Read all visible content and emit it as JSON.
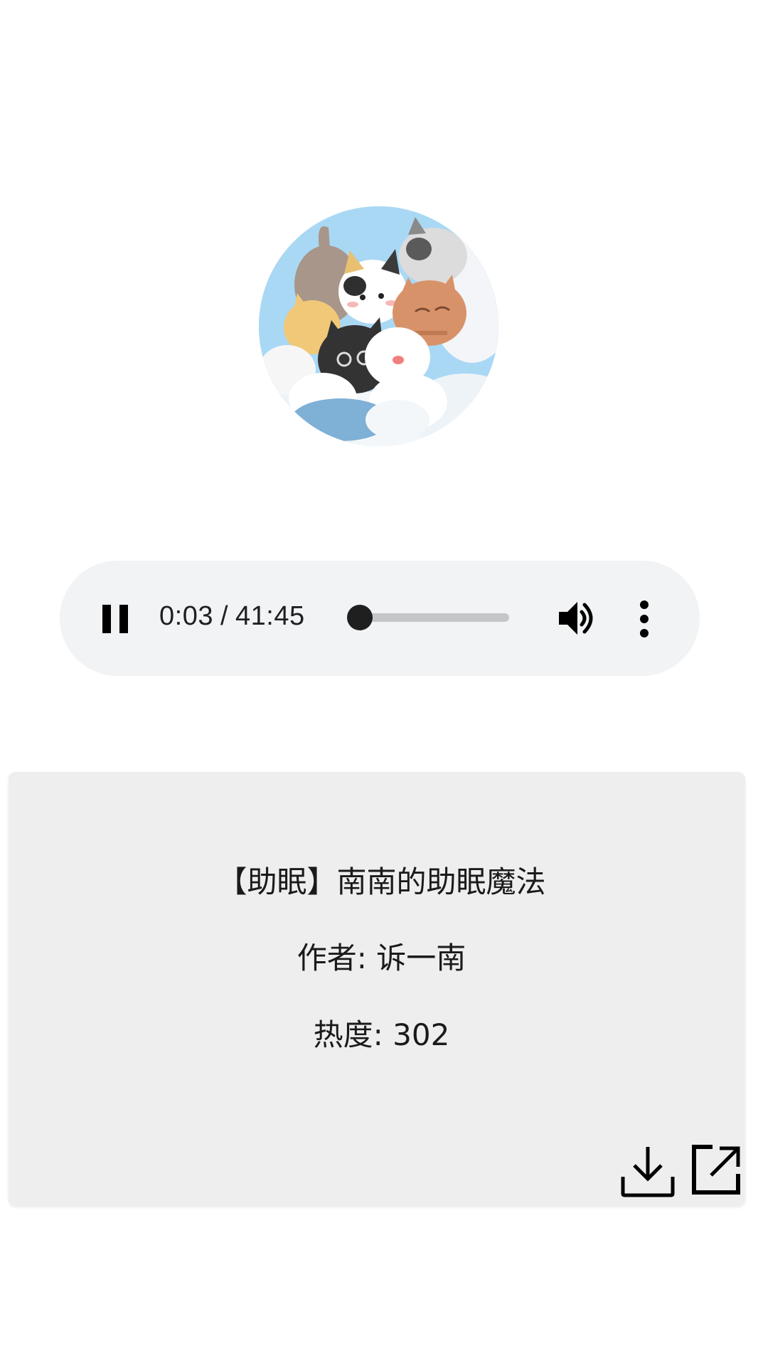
{
  "cover": {
    "icon": "cats-cover-art"
  },
  "player": {
    "current_time": "0:03",
    "separator": "/",
    "duration": "41:45",
    "progress_fraction": 0.0012,
    "state": "playing",
    "icons": {
      "play_pause": "pause-icon",
      "volume": "volume-icon",
      "more": "more-vertical-icon"
    }
  },
  "card": {
    "title": "【助眠】南南的助眠魔法",
    "author": "作者: 诉一南",
    "heat": "热度: 302",
    "icons": {
      "download": "download-icon",
      "share": "share-icon"
    }
  },
  "colors": {
    "player_bg": "#f1f3f4",
    "card_bg": "#eeeeef",
    "text": "#1a1a1a"
  }
}
